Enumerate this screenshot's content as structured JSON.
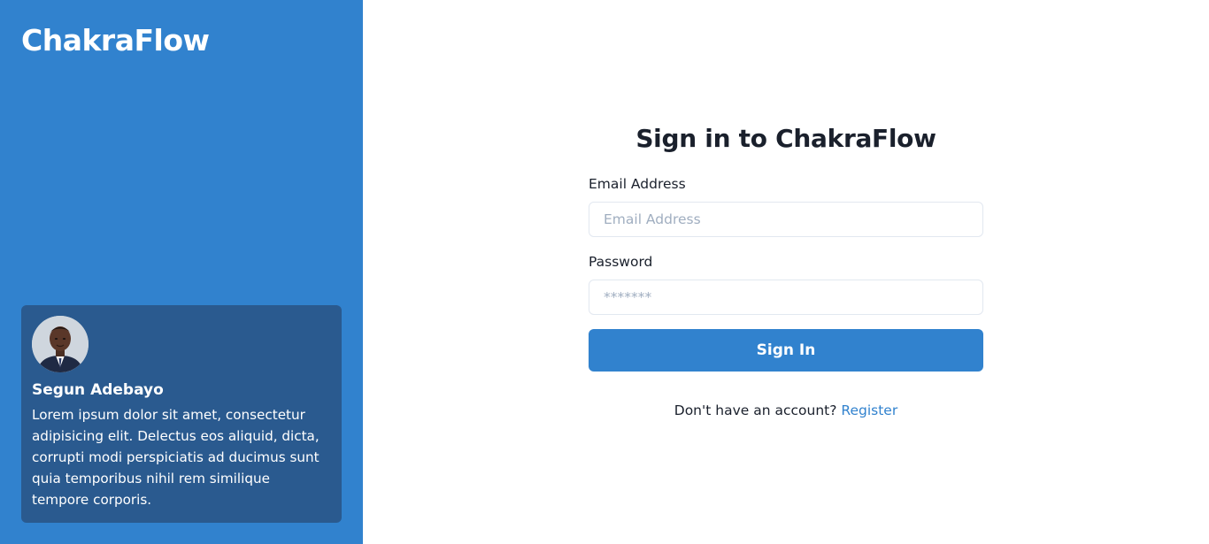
{
  "brand": {
    "logo_text": "ChakraFlow"
  },
  "testimonial": {
    "avatar_icon": "user-avatar-photo",
    "name": "Segun Adebayo",
    "quote": "Lorem ipsum dolor sit amet, consectetur adipisicing elit. Delectus eos aliquid, dicta, corrupti modi perspiciatis ad ducimus sunt quia temporibus nihil rem similique tempore corporis."
  },
  "form": {
    "title": "Sign in to ChakraFlow",
    "email": {
      "label": "Email Address",
      "value": "",
      "placeholder": "Email Address"
    },
    "password": {
      "label": "Password",
      "value": "",
      "placeholder": "*******"
    },
    "submit_label": "Sign In",
    "register_prompt": "Don't have an account?",
    "register_link": "Register"
  },
  "colors": {
    "brand_blue": "#3182ce",
    "card_blue": "#2a5a8f",
    "text_dark": "#1a202c",
    "input_border": "#e2e8f0",
    "placeholder": "#a0aec0"
  }
}
